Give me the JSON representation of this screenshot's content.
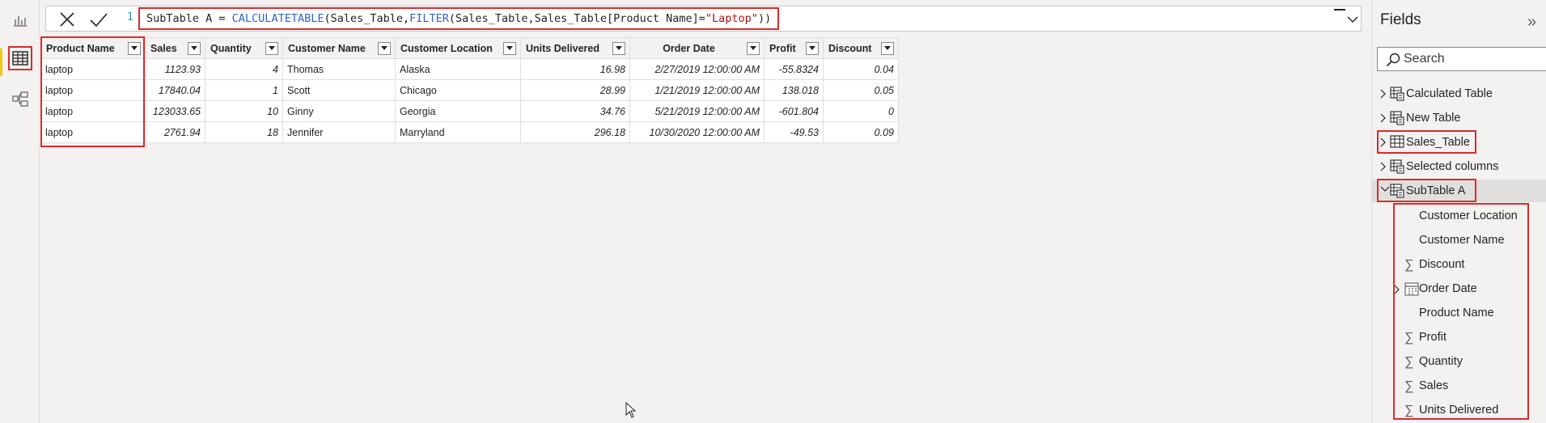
{
  "formula": {
    "line_number": "1",
    "expr_name": "SubTable A = ",
    "func1": "CALCULATETABLE",
    "arg1": "(Sales_Table,",
    "func2": "FILTER",
    "arg2": "(Sales_Table,Sales_Table[Product Name]=",
    "str": "\"Laptop\"",
    "close": "))"
  },
  "grid": {
    "columns": [
      "Product Name",
      "Sales",
      "Quantity",
      "Customer Name",
      "Customer Location",
      "Units Delivered",
      "Order Date",
      "Profit",
      "Discount"
    ],
    "rows": [
      [
        "laptop",
        "1123.93",
        "4",
        "Thomas",
        "Alaska",
        "16.98",
        "2/27/2019 12:00:00 AM",
        "-55.8324",
        "0.04"
      ],
      [
        "laptop",
        "17840.04",
        "1",
        "Scott",
        "Chicago",
        "28.99",
        "1/21/2019 12:00:00 AM",
        "138.018",
        "0.05"
      ],
      [
        "laptop",
        "123033.65",
        "10",
        "Ginny",
        "Georgia",
        "34.76",
        "5/21/2019 12:00:00 AM",
        "-601.804",
        "0"
      ],
      [
        "laptop",
        "2761.94",
        "18",
        "Jennifer",
        "Marryland",
        "296.18",
        "10/30/2020 12:00:00 AM",
        "-49.53",
        "0.09"
      ]
    ]
  },
  "fields_pane": {
    "title": "Fields",
    "collapse_glyph": "»",
    "search_placeholder": "Search",
    "tables": [
      {
        "label": "Calculated Table"
      },
      {
        "label": "New Table"
      },
      {
        "label": "Sales_Table"
      },
      {
        "label": "Selected columns"
      },
      {
        "label": "SubTable A"
      }
    ],
    "subtable_fields": [
      {
        "label": "Customer Location",
        "icon": ""
      },
      {
        "label": "Customer Name",
        "icon": ""
      },
      {
        "label": "Discount",
        "icon": "∑"
      },
      {
        "label": "Order Date",
        "icon": "calendar-icon"
      },
      {
        "label": "Product Name",
        "icon": ""
      },
      {
        "label": "Profit",
        "icon": "∑"
      },
      {
        "label": "Quantity",
        "icon": "∑"
      },
      {
        "label": "Sales",
        "icon": "∑"
      },
      {
        "label": "Units Delivered",
        "icon": "∑"
      }
    ]
  },
  "colors": {
    "highlight": "#d92b2b",
    "accent": "#f2c811",
    "dax_function": "#2f64c8",
    "dax_string": "#a31515"
  }
}
